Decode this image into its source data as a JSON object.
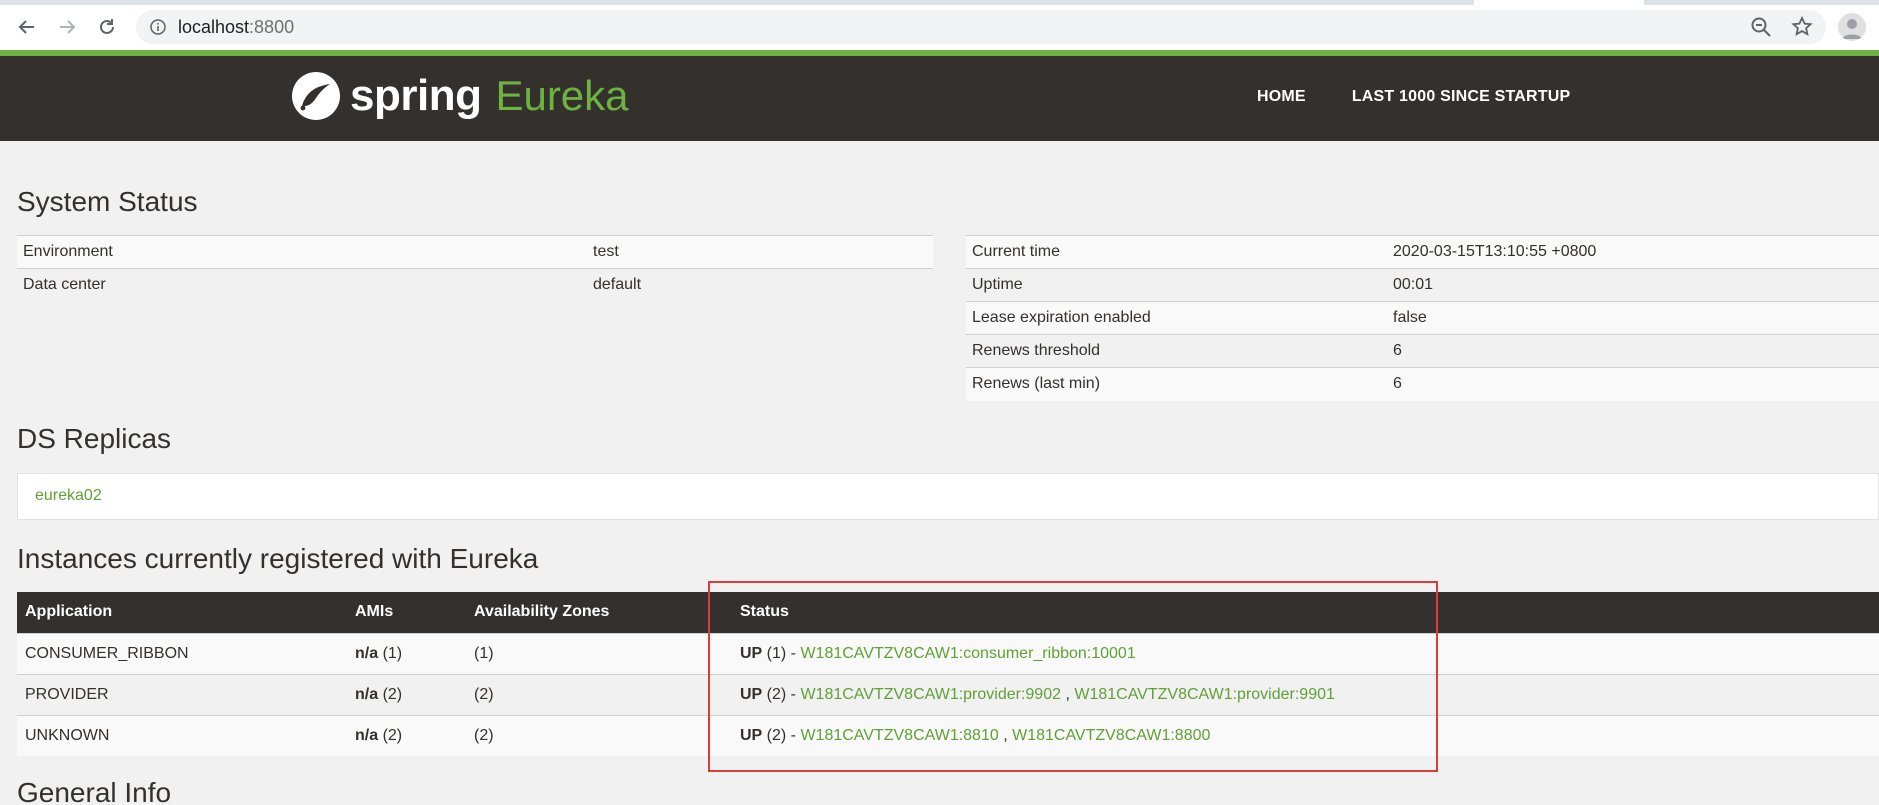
{
  "browser": {
    "url_host": "localhost",
    "url_port": ":8800"
  },
  "brand": {
    "spring": "spring",
    "eureka": "Eureka"
  },
  "nav": {
    "home": "HOME",
    "last1000": "LAST 1000 SINCE STARTUP"
  },
  "system_status": {
    "title": "System Status",
    "left": [
      {
        "label": "Environment",
        "value": "test"
      },
      {
        "label": "Data center",
        "value": "default"
      }
    ],
    "right": [
      {
        "label": "Current time",
        "value": "2020-03-15T13:10:55 +0800"
      },
      {
        "label": "Uptime",
        "value": "00:01"
      },
      {
        "label": "Lease expiration enabled",
        "value": "false"
      },
      {
        "label": "Renews threshold",
        "value": "6"
      },
      {
        "label": "Renews (last min)",
        "value": "6"
      }
    ]
  },
  "ds_replicas": {
    "title": "DS Replicas",
    "items": [
      "eureka02"
    ]
  },
  "instances": {
    "title": "Instances currently registered with Eureka",
    "headers": [
      "Application",
      "AMIs",
      "Availability Zones",
      "Status"
    ],
    "rows": [
      {
        "application": "CONSUMER_RIBBON",
        "ami_label": "n/a",
        "ami_count": " (1)",
        "zones": "(1)",
        "status_label": "UP",
        "status_count": " (1) - ",
        "links": [
          "W181CAVTZV8CAW1:consumer_ribbon:10001"
        ]
      },
      {
        "application": "PROVIDER",
        "ami_label": "n/a",
        "ami_count": " (2)",
        "zones": "(2)",
        "status_label": "UP",
        "status_count": " (2) - ",
        "links": [
          "W181CAVTZV8CAW1:provider:9902",
          "W181CAVTZV8CAW1:provider:9901"
        ]
      },
      {
        "application": "UNKNOWN",
        "ami_label": "n/a",
        "ami_count": " (2)",
        "zones": "(2)",
        "status_label": "UP",
        "status_count": " (2) - ",
        "links": [
          "W181CAVTZV8CAW1:8810",
          "W181CAVTZV8CAW1:8800"
        ]
      }
    ],
    "link_separator": " , "
  },
  "general_info": {
    "title": "General Info"
  },
  "colors": {
    "accent_green": "#6db33f",
    "header_dark": "#34302d",
    "highlight_red": "#e03b3b"
  }
}
